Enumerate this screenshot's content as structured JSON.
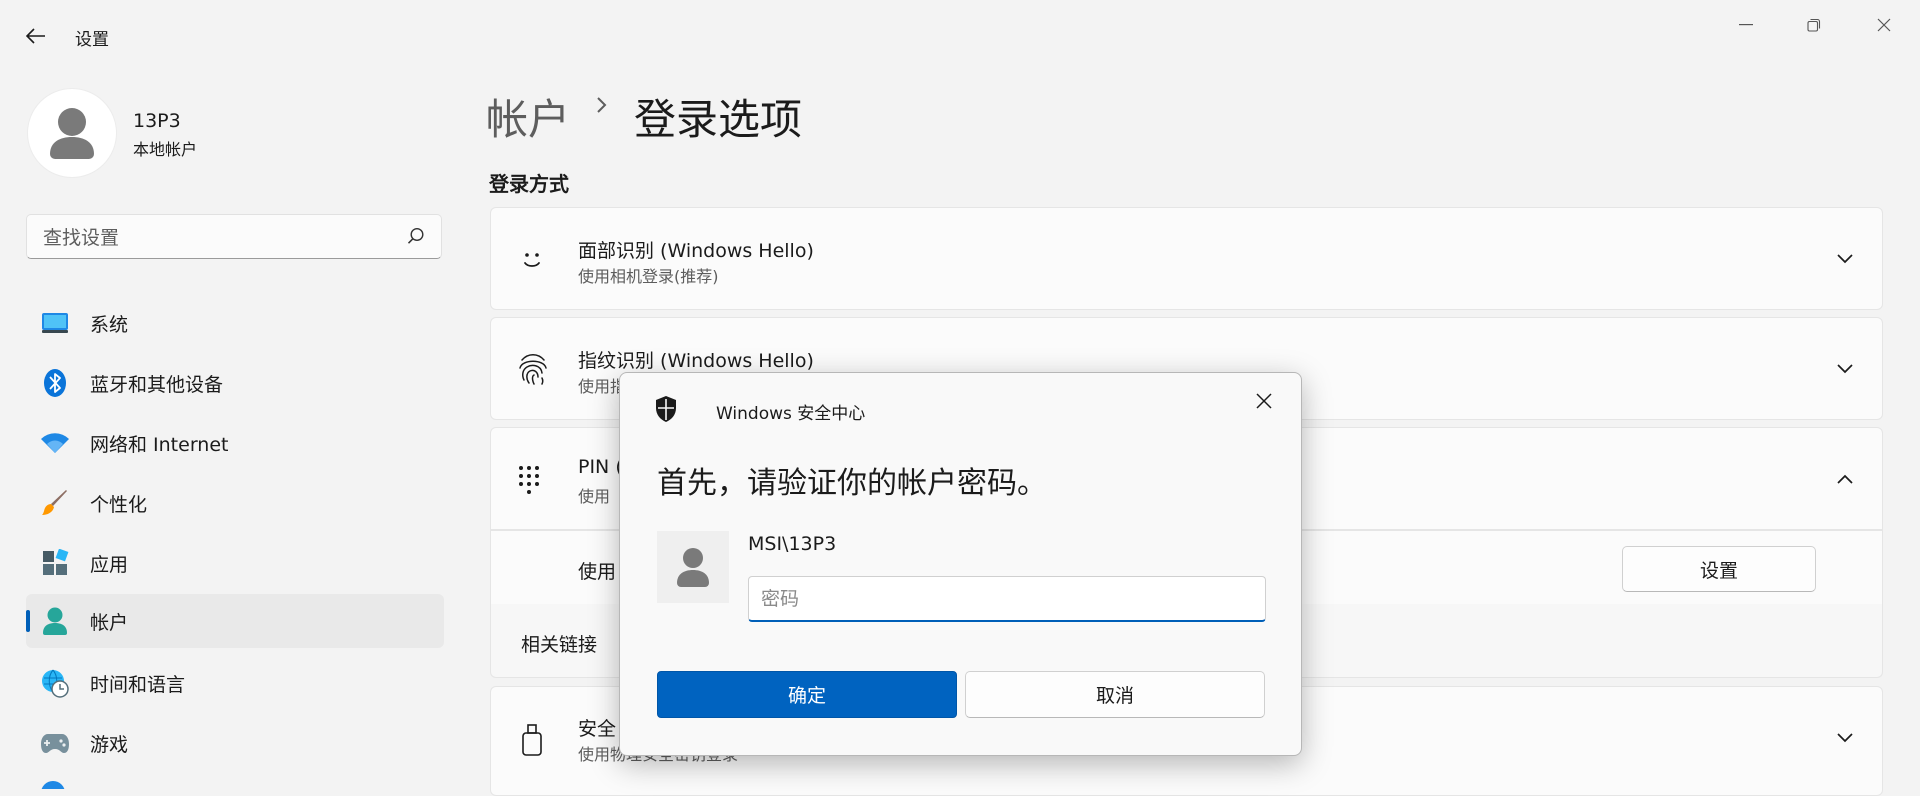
{
  "titlebar": {
    "app_title": "设置"
  },
  "sidebar": {
    "user": {
      "name": "13P3",
      "type": "本地帐户"
    },
    "search": {
      "placeholder": "查找设置"
    },
    "items": [
      {
        "label": "系统",
        "icon": "system-icon"
      },
      {
        "label": "蓝牙和其他设备",
        "icon": "bluetooth-icon"
      },
      {
        "label": "网络和 Internet",
        "icon": "wifi-icon"
      },
      {
        "label": "个性化",
        "icon": "brush-icon"
      },
      {
        "label": "应用",
        "icon": "apps-icon"
      },
      {
        "label": "帐户",
        "icon": "account-icon",
        "selected": true
      },
      {
        "label": "时间和语言",
        "icon": "globe-clock-icon"
      },
      {
        "label": "游戏",
        "icon": "gamepad-icon"
      }
    ]
  },
  "main": {
    "breadcrumb": {
      "parent": "帐户",
      "current": "登录选项"
    },
    "section_title": "登录方式",
    "cards": [
      {
        "title": "面部识别 (Windows Hello)",
        "subtitle": "使用相机登录(推荐)"
      },
      {
        "title": "指纹识别 (Windows Hello)",
        "subtitle": "使用指"
      },
      {
        "title": "PIN (",
        "subtitle": "使用"
      },
      {
        "title": "安全",
        "subtitle": "使用物理安全密钥登录"
      }
    ],
    "pin_row": {
      "text": "使用",
      "button_label": "设置"
    },
    "related_links": "相关链接"
  },
  "dialog": {
    "title": "Windows 安全中心",
    "heading": "首先，请验证你的帐户密码。",
    "username": "MSI\\13P3",
    "password_placeholder": "密码",
    "ok_label": "确定",
    "cancel_label": "取消"
  },
  "colors": {
    "accent": "#005fb8",
    "primary_button": "#0063c0",
    "background": "#f3f3f3",
    "card": "#fbfbfb"
  }
}
